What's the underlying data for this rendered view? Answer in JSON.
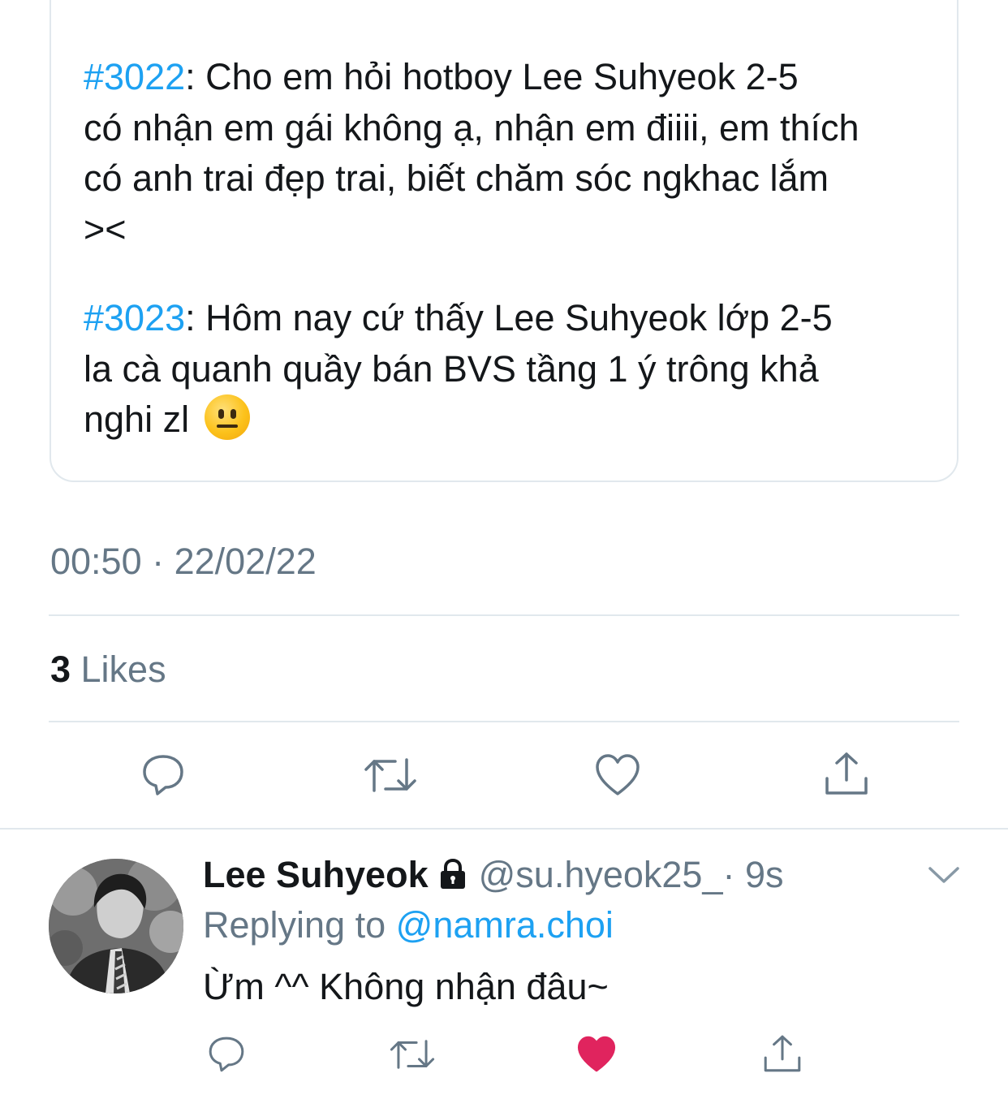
{
  "quoted_tweet": {
    "entries": [
      {
        "hashtag": "#3022",
        "lines": [
          ":  Cho em hỏi hotboy Lee Suhyeok 2-5",
          "có nhận em gái không ạ, nhận em điiii, em thích",
          "có anh trai đẹp trai, biết chăm sóc ngkhac lắm",
          "><"
        ]
      },
      {
        "hashtag": "#3023",
        "lines": [
          ": Hôm nay cứ thấy Lee Suhyeok lớp 2-5",
          "la cà quanh quầy bán BVS tầng 1 ý trông khả",
          "nghi zl"
        ],
        "emoji": "neutral-face-emoji"
      }
    ]
  },
  "timestamp": "00:50 · 22/02/22",
  "likes": {
    "count": "3",
    "label": " Likes"
  },
  "actions": {
    "reply_icon": "reply-icon",
    "retweet_icon": "retweet-icon",
    "like_icon": "heart-icon",
    "share_icon": "share-icon"
  },
  "reply": {
    "name": "Lee Suhyeok",
    "handle": "@su.hyeok25_",
    "time": "· 9s",
    "replying_prefix": "Replying to ",
    "replying_to": "@namra.choi",
    "text": "Ừm ^^ Không nhận đâu~",
    "liked": true,
    "like_color": "#e0245e"
  },
  "colors": {
    "link": "#1da1f2",
    "secondary_text": "#657786",
    "divider": "#e1e8ed"
  }
}
